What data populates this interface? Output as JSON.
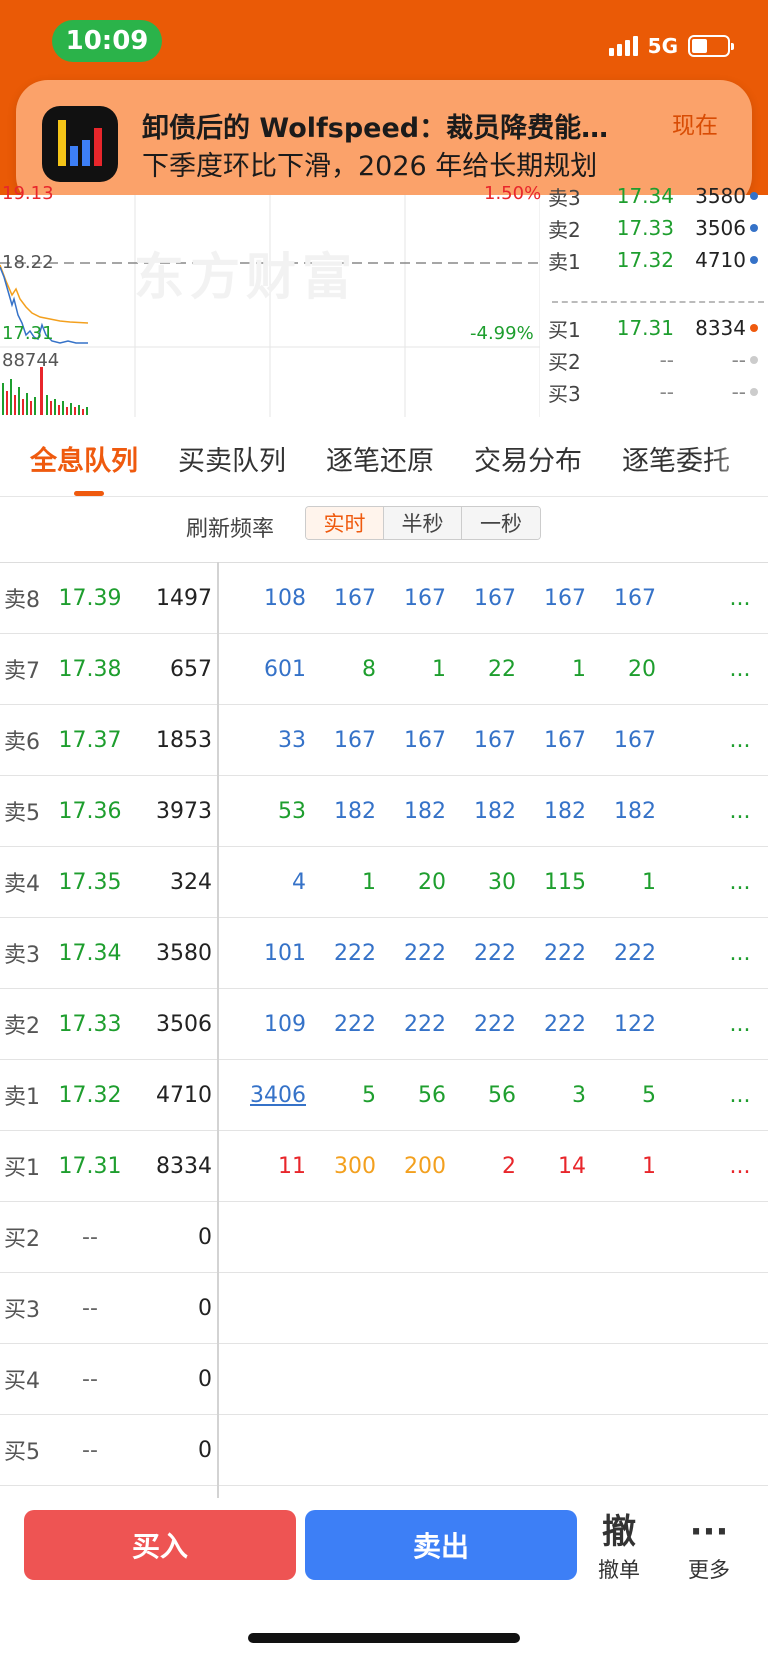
{
  "status": {
    "time": "10:09",
    "network": "5G"
  },
  "notification": {
    "title": "卸债后的 Wolfspeed：裁员降费能…",
    "body": "下季度环比下滑，2026 年给长期规划",
    "time": "现在"
  },
  "chart": {
    "price_top": "19.13",
    "pct_top": "1.50%",
    "ref_price": "18.22",
    "current_price": "17.31",
    "pct_change": "-4.99%",
    "volume": "88744",
    "watermark": "东方财富",
    "colors": {
      "up": "#e8262b",
      "down": "#1e9e2e",
      "price_line": "#3572c8",
      "avg_line": "#f3a01e"
    }
  },
  "mini_book": [
    {
      "label": "卖3",
      "price": "17.34",
      "vol": "3580",
      "dot": "#3572c8"
    },
    {
      "label": "卖2",
      "price": "17.33",
      "vol": "3506",
      "dot": "#3572c8"
    },
    {
      "label": "卖1",
      "price": "17.32",
      "vol": "4710",
      "dot": "#3572c8"
    },
    {
      "label": "买1",
      "price": "17.31",
      "vol": "8334",
      "dot": "#ef5a0e"
    },
    {
      "label": "买2",
      "price": "--",
      "vol": "--",
      "dot": "#cccccc"
    },
    {
      "label": "买3",
      "price": "--",
      "vol": "--",
      "dot": "#cccccc"
    }
  ],
  "tabs": [
    "全息队列",
    "买卖队列",
    "逐笔还原",
    "交易分布",
    "逐笔委托"
  ],
  "refresh": {
    "label": "刷新频率",
    "options": [
      "实时",
      "半秒",
      "一秒"
    ],
    "selected": "实时"
  },
  "queue": [
    {
      "label": "卖8",
      "price": "17.39",
      "vol": "1497",
      "orders": [
        "108",
        "167",
        "167",
        "167",
        "167",
        "167"
      ],
      "colors": [
        "blue",
        "blue",
        "blue",
        "blue",
        "blue",
        "blue"
      ],
      "more": "...",
      "more_color": "green"
    },
    {
      "label": "卖7",
      "price": "17.38",
      "vol": "657",
      "orders": [
        "601",
        "8",
        "1",
        "22",
        "1",
        "20"
      ],
      "colors": [
        "blue",
        "green",
        "green",
        "green",
        "green",
        "green"
      ],
      "more": "...",
      "more_color": "green"
    },
    {
      "label": "卖6",
      "price": "17.37",
      "vol": "1853",
      "orders": [
        "33",
        "167",
        "167",
        "167",
        "167",
        "167"
      ],
      "colors": [
        "blue",
        "blue",
        "blue",
        "blue",
        "blue",
        "blue"
      ],
      "more": "...",
      "more_color": "green"
    },
    {
      "label": "卖5",
      "price": "17.36",
      "vol": "3973",
      "orders": [
        "53",
        "182",
        "182",
        "182",
        "182",
        "182"
      ],
      "colors": [
        "green",
        "blue",
        "blue",
        "blue",
        "blue",
        "blue"
      ],
      "more": "...",
      "more_color": "green"
    },
    {
      "label": "卖4",
      "price": "17.35",
      "vol": "324",
      "orders": [
        "4",
        "1",
        "20",
        "30",
        "115",
        "1"
      ],
      "colors": [
        "blue",
        "green",
        "green",
        "green",
        "green",
        "green"
      ],
      "more": "...",
      "more_color": "green"
    },
    {
      "label": "卖3",
      "price": "17.34",
      "vol": "3580",
      "orders": [
        "101",
        "222",
        "222",
        "222",
        "222",
        "222"
      ],
      "colors": [
        "blue",
        "blue",
        "blue",
        "blue",
        "blue",
        "blue"
      ],
      "more": "...",
      "more_color": "green"
    },
    {
      "label": "卖2",
      "price": "17.33",
      "vol": "3506",
      "orders": [
        "109",
        "222",
        "222",
        "222",
        "222",
        "122"
      ],
      "colors": [
        "blue",
        "blue",
        "blue",
        "blue",
        "blue",
        "blue"
      ],
      "more": "...",
      "more_color": "green"
    },
    {
      "label": "卖1",
      "price": "17.32",
      "vol": "4710",
      "orders": [
        "3406",
        "5",
        "56",
        "56",
        "3",
        "5"
      ],
      "colors": [
        "blue-u",
        "green",
        "green",
        "green",
        "green",
        "green"
      ],
      "more": "...",
      "more_color": "green"
    },
    {
      "label": "买1",
      "price": "17.31",
      "vol": "8334",
      "orders": [
        "11",
        "300",
        "200",
        "2",
        "14",
        "1"
      ],
      "colors": [
        "red",
        "orange",
        "orange",
        "red",
        "red",
        "red"
      ],
      "more": "...",
      "more_color": "red"
    },
    {
      "label": "买2",
      "price": "--",
      "vol": "0",
      "orders": [],
      "colors": [],
      "more": "",
      "more_color": ""
    },
    {
      "label": "买3",
      "price": "--",
      "vol": "0",
      "orders": [],
      "colors": [],
      "more": "",
      "more_color": ""
    },
    {
      "label": "买4",
      "price": "--",
      "vol": "0",
      "orders": [],
      "colors": [],
      "more": "",
      "more_color": ""
    },
    {
      "label": "买5",
      "price": "--",
      "vol": "0",
      "orders": [],
      "colors": [],
      "more": "",
      "more_color": ""
    }
  ],
  "bottom": {
    "buy": "买入",
    "sell": "卖出",
    "cancel_icon": "撤",
    "cancel": "撤单",
    "more_icon": "···",
    "more": "更多"
  }
}
